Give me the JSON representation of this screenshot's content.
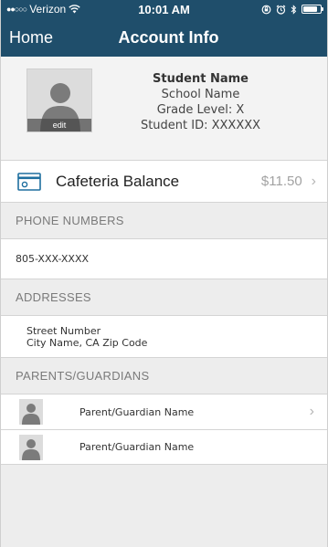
{
  "status_bar": {
    "signal_dots": "●●○○○",
    "carrier": "Verizon",
    "wifi_icon": "wifi-icon",
    "time": "10:01 AM",
    "battery_level": 0.85
  },
  "nav": {
    "back_label": "Home",
    "title": "Account Info"
  },
  "profile": {
    "edit_label": "edit",
    "name": "Student Name",
    "school": "School Name",
    "grade": "Grade Level: X",
    "student_id": "Student ID: XXXXXX"
  },
  "cafeteria": {
    "label": "Cafeteria Balance",
    "amount": "$11.50",
    "chevron": "›"
  },
  "phone_section": {
    "header": "PHONE NUMBERS",
    "number": "805-XXX-XXXX"
  },
  "address_section": {
    "header": "ADDRESSES",
    "line1": "Street Number",
    "line2": "City Name, CA Zip Code"
  },
  "guardians_section": {
    "header": "PARENTS/GUARDIANS",
    "items": [
      {
        "name": "Parent/Guardian Name",
        "chevron": "›"
      },
      {
        "name": "Parent/Guardian Name"
      }
    ]
  },
  "colors": {
    "nav_background": "#1f4e6b",
    "page_background": "#ededed",
    "accent_icon": "#1f6f9f"
  }
}
